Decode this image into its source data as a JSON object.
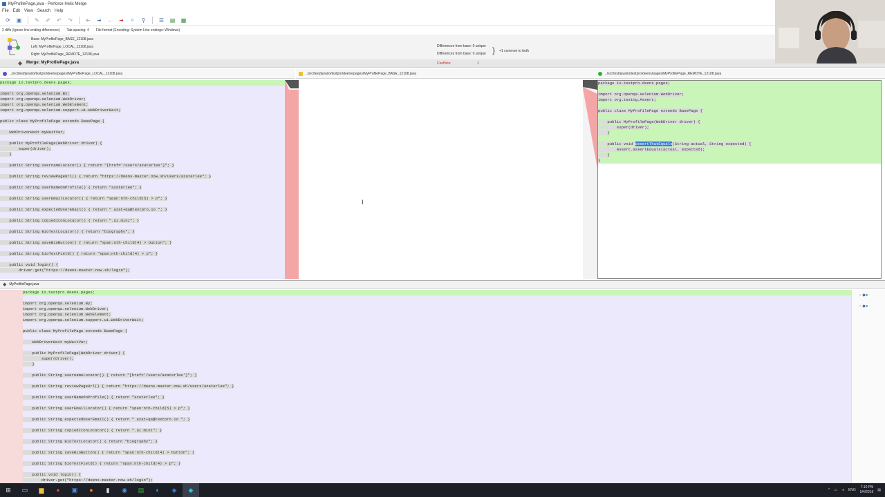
{
  "window": {
    "title": "MyProfilePage.java - Perforce Helix Merge"
  },
  "menu": [
    "File",
    "Edit",
    "View",
    "Search",
    "Help"
  ],
  "status": {
    "diffs": "2 diffs (Ignore line ending differences)",
    "tab_spacing": "Tab spacing: 4",
    "file_format": "File format (Encoding: System  Line endings: Windows)"
  },
  "files": {
    "base": "Base: MyProfilePage_BASE_12108.java",
    "left": "Left: MyProfilePage_LOCAL_12108.java",
    "right": "Right: MyProfilePage_REMOTE_12108.java",
    "merge": "Merge: MyProfilePage.java",
    "diff_left": "Differences from base: 0 unique",
    "diff_right": "Differences from base: 0 unique",
    "common": "+1 common to both",
    "conflicts_label": "Conflicts:",
    "conflicts_value": "1"
  },
  "panes": {
    "left_path": "../src/test/java/io/testpro/deens/pages/MyProfilePage_LOCAL_12108.java",
    "base_path": "../src/test/java/io/testpro/deens/pages/MyProfilePage_BASE_12108.java",
    "right_path": "../src/test/java/io/testpro/deens/pages/MyProfilePage_REMOTE_12108.java",
    "merge_name": "MyProfilePage.java"
  },
  "code": {
    "left": [
      "package io.testpro.deens.pages;",
      "",
      "import org.openqa.selenium.By;",
      "import org.openqa.selenium.WebDriver;",
      "import org.openqa.selenium.WebElement;",
      "import org.openqa.selenium.support.ui.WebDriverWait;",
      "",
      "public class MyProfilePage extends BasePage {",
      "",
      "    WebDriverWait myWaitVar;",
      "",
      "    public MyProfilePage(WebDriver driver) {",
      "        super(driver);",
      "    }",
      "",
      "    public String usernameLocator() { return \"[href='/users/azaterlee']\"; }",
      "",
      "    public String reviewPageUrl() { return \"https://deens-master.now.sh/users/azaterlee\"; }",
      "",
      "    public String userNameOnProfile() { return \"azaterlee\"; }",
      "",
      "    public String userEmailLocator() { return \"span:nth-child(5) > p\"; }",
      "",
      "    public String expectedUserEmail() { return \" azat+qa@testpro.io \"; }",
      "",
      "    public String copiedIconLocator() { return \".ui.mini\"; }",
      "",
      "    public String BioTextLocator() { return \"biography\"; }",
      "",
      "    public String saveBioButton() { return \"span:nth-child(4) > button\"; }",
      "",
      "    public String bioTextField() { return \"span:nth-child(4) > p\"; }",
      "",
      "    public void login() {",
      "        driver.get(\"https://deens-master.now.sh/login\");"
    ],
    "right": [
      "package io.testpro.deens.pages;",
      "",
      "import org.openqa.selenium.WebDriver;",
      "import org.testng.Assert;",
      "",
      "public class MyProfilePage extends BasePage {",
      "",
      "    public MyProfilePage(WebDriver driver) {",
      "        super(driver);",
      "    }",
      "",
      "    public void ",
      "        Assert.assertEquals(actual, expected);",
      "    }",
      "}"
    ],
    "right_method_name": "assertThatEquals",
    "right_method_tail": "(String actual, String expected) {"
  },
  "taskbar": {
    "lang": "ENG",
    "time": "7:10 PM",
    "date": "5/4/2019"
  }
}
